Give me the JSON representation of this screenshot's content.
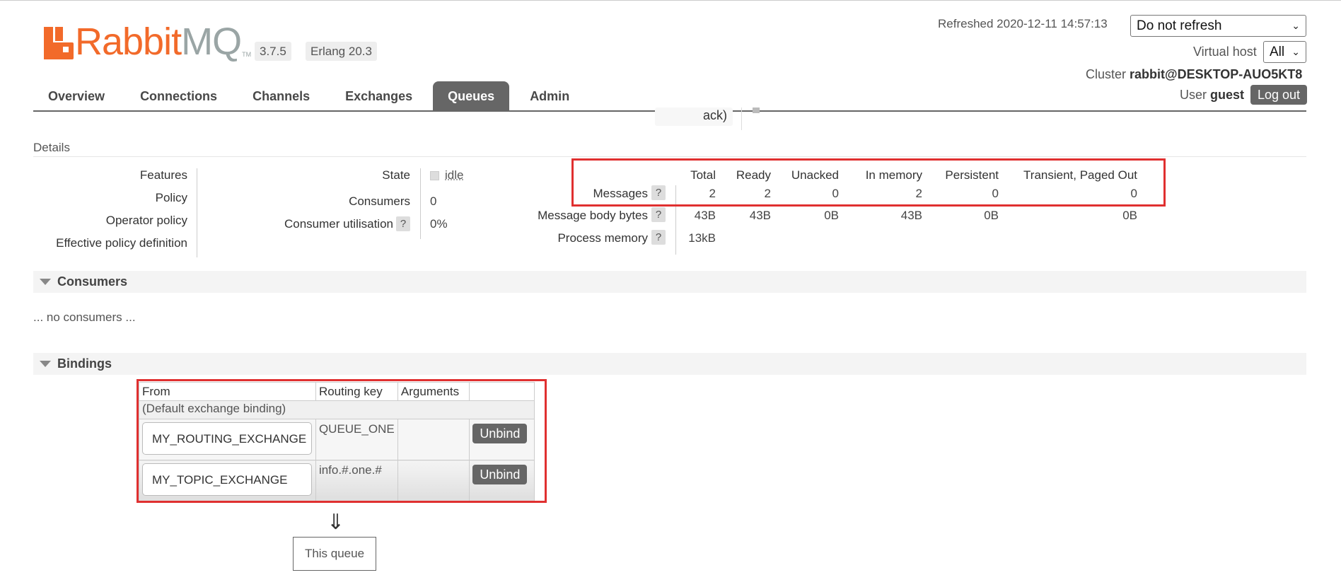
{
  "logo": {
    "part1": "Rabbit",
    "part2": "MQ",
    "tm": "TM"
  },
  "versions": {
    "rabbitmq": "3.7.5",
    "erlang": "Erlang 20.3"
  },
  "header": {
    "refreshed_label": "Refreshed 2020-12-11 14:57:13",
    "refresh_select": "Do not refresh",
    "vhost_label": "Virtual host",
    "vhost_select": "All",
    "cluster_label": "Cluster",
    "cluster_name": "rabbit@DESKTOP-AUO5KT8",
    "user_label": "User",
    "user_name": "guest",
    "logout_label": "Log out"
  },
  "nav": {
    "tabs": [
      "Overview",
      "Connections",
      "Channels",
      "Exchanges",
      "Queues",
      "Admin"
    ],
    "active": "Queues"
  },
  "faded": {
    "text": "ack)"
  },
  "details": {
    "title": "Details",
    "features_labels": [
      "Features",
      "Policy",
      "Operator policy",
      "Effective policy definition"
    ],
    "state_label": "State",
    "state_value": "idle",
    "consumers_label": "Consumers",
    "consumers_value": "0",
    "utilisation_label": "Consumer utilisation",
    "utilisation_value": "0%",
    "help": "?"
  },
  "messages": {
    "headers": [
      "Total",
      "Ready",
      "Unacked",
      "In memory",
      "Persistent",
      "Transient, Paged Out"
    ],
    "rows": [
      {
        "label": "Messages",
        "values": [
          "2",
          "2",
          "0",
          "2",
          "0",
          "0"
        ]
      },
      {
        "label": "Message body bytes",
        "values": [
          "43B",
          "43B",
          "0B",
          "43B",
          "0B",
          "0B"
        ]
      },
      {
        "label": "Process memory",
        "values": [
          "13kB"
        ]
      }
    ]
  },
  "consumers": {
    "title": "Consumers",
    "empty": "... no consumers ..."
  },
  "bindings": {
    "title": "Bindings",
    "columns": [
      "From",
      "Routing key",
      "Arguments",
      ""
    ],
    "default_row": "(Default exchange binding)",
    "rows": [
      {
        "from": "MY_ROUTING_EXCHANGE",
        "routing_key": "QUEUE_ONE",
        "arguments": "",
        "action": "Unbind"
      },
      {
        "from": "MY_TOPIC_EXCHANGE",
        "routing_key": "info.#.one.#",
        "arguments": "",
        "action": "Unbind"
      }
    ],
    "arrow": "⇓",
    "this_queue": "This queue"
  }
}
